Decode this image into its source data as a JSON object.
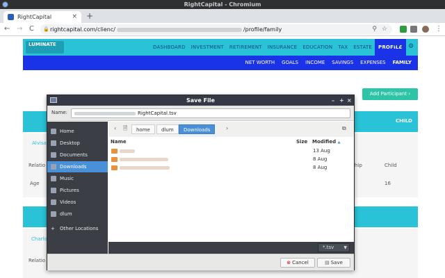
{
  "window": {
    "title": "RightCapital - Chromium"
  },
  "browser": {
    "tab_title": "RightCapital",
    "tab_close": "×",
    "new_tab": "+",
    "url_prefix": "rightcapital.com/clienc/",
    "url_suffix": "/profile/family",
    "nav": {
      "back": "←",
      "forward": "→",
      "reload": "C"
    }
  },
  "app": {
    "logo_text": "LUMINATE",
    "logo_sub": "",
    "nav_items": [
      "DASHBOARD",
      "INVESTMENT",
      "RETIREMENT",
      "INSURANCE",
      "EDUCATION",
      "TAX",
      "ESTATE",
      "PROFILE"
    ],
    "nav_active": "PROFILE",
    "more": "•••",
    "gear": "⚙",
    "subnav_items": [
      "NET WORTH",
      "GOALS",
      "INCOME",
      "SAVINGS",
      "EXPENSES",
      "FAMILY"
    ],
    "subnav_active": "FAMILY",
    "add_participant": "Add Participant ›",
    "bg": {
      "child_header": "CHILD",
      "relationship_short": "Relatio",
      "ship": "hip",
      "child_value": "Child",
      "age_label": "Age",
      "age_value": "16",
      "name_short_1": "Alvisa",
      "name_short_2": "Charlo",
      "relationship_short_2": "Relatio"
    }
  },
  "dialog": {
    "title": "Save File",
    "name_label": "Name:",
    "filename": "RightCapital.tsv",
    "places": [
      "Home",
      "Desktop",
      "Documents",
      "Downloads",
      "Music",
      "Pictures",
      "Videos",
      "dlum",
      "Other Locations"
    ],
    "places_active": "Downloads",
    "other_prefix": "+",
    "path": [
      "home",
      "dlum",
      "Downloads"
    ],
    "path_active": "Downloads",
    "columns": {
      "name": "Name",
      "size": "Size",
      "modified": "Modified"
    },
    "sort_indicator": "▲",
    "files": [
      {
        "modified": "13 Aug"
      },
      {
        "modified": "8 Aug"
      },
      {
        "modified": "8 Aug"
      }
    ],
    "filter": "*.tsv",
    "cancel": "Cancel",
    "save": "Save",
    "win_buttons": {
      "minimize": "–",
      "maximize": "+",
      "close": "×"
    }
  }
}
